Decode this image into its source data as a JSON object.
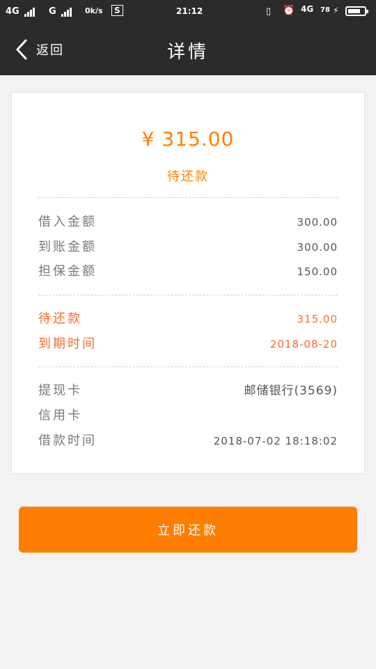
{
  "status_bar": {
    "net1": "4G",
    "net2": "G",
    "speed": "0k/s",
    "time": "21:12",
    "net3": "4G",
    "battery_percent": "78",
    "battery_level": 0.78
  },
  "nav": {
    "back_label": "返回",
    "title": "详情"
  },
  "summary": {
    "amount": "¥ 315.00",
    "status": "待还款"
  },
  "loan_rows": [
    {
      "label": "借入金额",
      "value": "300.00"
    },
    {
      "label": "到账金额",
      "value": "300.00"
    },
    {
      "label": "担保金额",
      "value": "150.00"
    }
  ],
  "due_rows": [
    {
      "label": "待还款",
      "value": "315.00"
    },
    {
      "label": "到期时间",
      "value": "2018-08-20"
    }
  ],
  "card_rows": [
    {
      "label": "提现卡",
      "value": "邮储银行(3569)"
    },
    {
      "label": "信用卡",
      "value": ""
    },
    {
      "label": "借款时间",
      "value": "2018-07-02 18:18:02"
    }
  ],
  "actions": {
    "repay_label": "立即还款"
  },
  "colors": {
    "accent": "#ff7d00",
    "due_text": "#ff6a2b",
    "bar_bg": "#2b2b2b"
  }
}
